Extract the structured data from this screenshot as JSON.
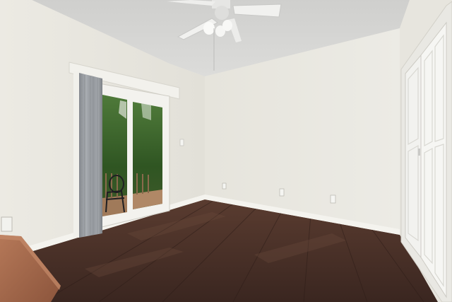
{
  "scene": {
    "kind": "empty bedroom interior photograph",
    "colors": {
      "ceiling": "#d8d8d6",
      "wall_light": "#ecebe4",
      "wall_shadow": "#dcdad2",
      "floor_dark": "#3a2620",
      "floor_mid": "#4e342a",
      "baseboard": "#f4f3ee",
      "curtain": "#9a9ea3",
      "foliage": "#3f6a2c",
      "deck": "#a07a5a",
      "closet_door": "#f2f2ef",
      "table_wood": "#a0664a"
    },
    "objects": [
      "ceiling-fan",
      "sliding-glass-door",
      "curtain-panel",
      "bifold-closet-doors",
      "hardwood-floor",
      "electrical-outlets",
      "wooden-table-corner"
    ]
  }
}
